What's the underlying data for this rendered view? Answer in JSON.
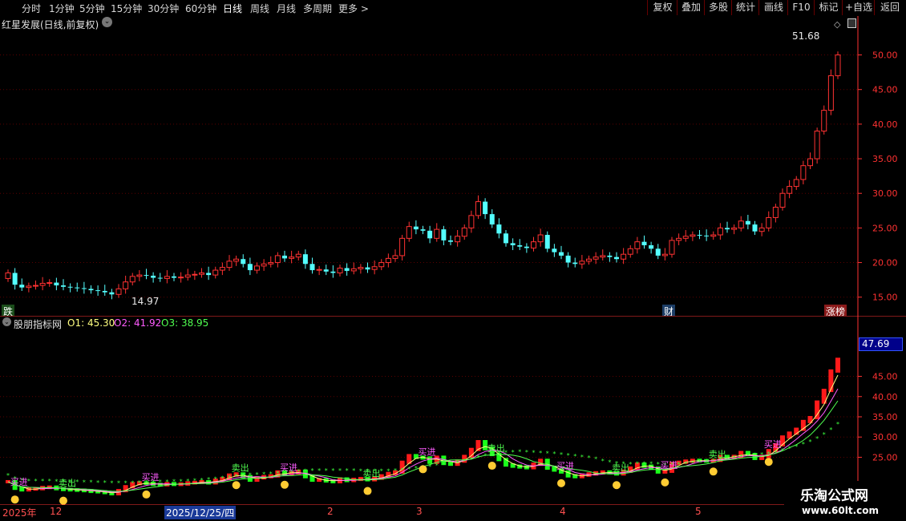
{
  "toolbar": {
    "periods": [
      "分时",
      "1分钟",
      "5分钟",
      "15分钟",
      "30分钟",
      "60分钟",
      "日线",
      "周线",
      "月线",
      "多周期",
      "更多 >"
    ],
    "active_period": "日线",
    "right_buttons": [
      "复权",
      "叠加",
      "多股",
      "统计",
      "画线",
      "F10",
      "标记",
      "+自选",
      "返回"
    ]
  },
  "upper_chart": {
    "title": "红星发展(日线,前复权)",
    "max_label": "51.68",
    "min_label": "14.97",
    "badges": {
      "left": "跌",
      "mid": "财",
      "right": "涨榜"
    },
    "colors": {
      "up": "#ff3232",
      "down": "#54ffff",
      "grid": "#5a0000",
      "axis": "#ff3232"
    }
  },
  "lower_chart": {
    "title": "股朋指标网",
    "o1_label": "O1: 45.30",
    "o2_label": "O2: 41.92",
    "o3_label": "O3: 38.95",
    "current_value": "47.69",
    "signals": {
      "buy": "买进",
      "sell": "卖出"
    },
    "colors": {
      "o1": "#ffff80",
      "o2": "#ff5cff",
      "o3": "#50ff50"
    }
  },
  "time_axis": {
    "labels": [
      "2025年",
      "12",
      "2025/12/25/四",
      "2",
      "3",
      "4",
      "5"
    ]
  },
  "watermark": {
    "line1": "乐淘公式网",
    "line2": "www.60lt.com"
  },
  "chart_data": [
    {
      "type": "candlestick",
      "title": "红星发展(日线,前复权)",
      "ylim": [
        13,
        54
      ],
      "yticks": [
        15,
        20,
        25,
        30,
        35,
        40,
        45,
        50
      ],
      "closes": [
        18.5,
        16.8,
        16.4,
        16.6,
        16.7,
        17.0,
        17.1,
        16.7,
        16.5,
        16.4,
        16.3,
        16.2,
        16.0,
        15.9,
        15.7,
        15.4,
        16.2,
        17.2,
        18.0,
        18.2,
        18.1,
        17.8,
        17.7,
        18.0,
        17.8,
        17.9,
        18.2,
        18.3,
        18.5,
        18.2,
        18.9,
        19.3,
        20.2,
        20.5,
        19.8,
        18.9,
        19.5,
        19.8,
        20.0,
        21.0,
        20.6,
        20.8,
        21.2,
        19.8,
        18.9,
        19.0,
        18.7,
        18.5,
        19.2,
        18.8,
        19.1,
        19.3,
        19.0,
        19.4,
        20.0,
        20.6,
        21.0,
        23.5,
        25.2,
        24.8,
        24.6,
        23.5,
        24.8,
        23.2,
        23.0,
        23.8,
        25.0,
        26.8,
        28.8,
        27.0,
        25.5,
        24.2,
        22.8,
        22.5,
        22.3,
        22.1,
        23.0,
        24.0,
        22.0,
        21.5,
        21.0,
        20.0,
        19.8,
        20.2,
        20.5,
        20.8,
        21.0,
        20.8,
        20.5,
        21.2,
        22.0,
        23.0,
        22.5,
        22.0,
        21.0,
        21.2,
        23.2,
        23.5,
        23.8,
        24.0,
        23.9,
        23.8,
        24.0,
        25.0,
        24.8,
        25.0,
        26.0,
        25.5,
        24.5,
        25.0,
        26.5,
        28.0,
        30.0,
        31.0,
        32.0,
        34.0,
        35.0,
        39.0,
        42.0,
        47.0,
        50.0
      ],
      "max_label": 51.68,
      "min_label": 14.97
    },
    {
      "type": "line",
      "title": "股朋指标网",
      "ylim": [
        14,
        56
      ],
      "yticks": [
        25,
        30,
        35,
        40,
        45
      ],
      "series": [
        {
          "name": "O1",
          "last": 45.3
        },
        {
          "name": "O2",
          "last": 41.92
        },
        {
          "name": "O3",
          "last": 38.95
        }
      ],
      "current": 47.69
    }
  ]
}
